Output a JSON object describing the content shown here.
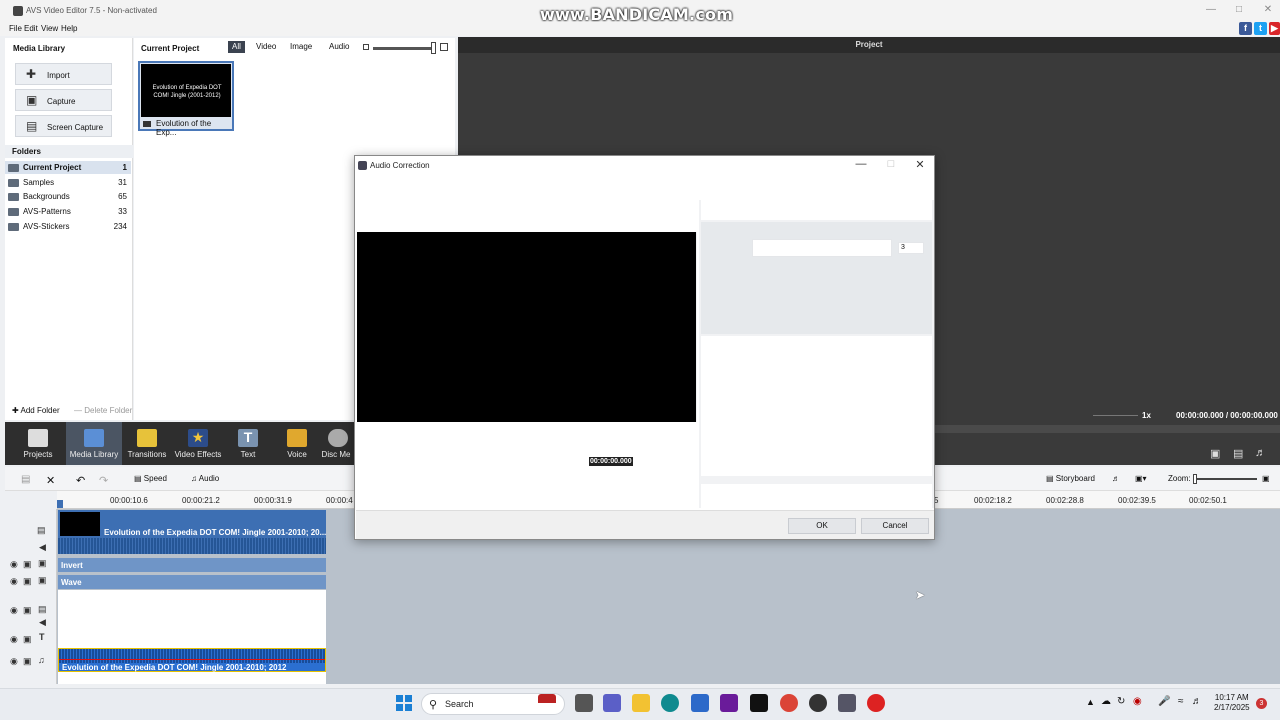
{
  "window": {
    "title": "AVS Video Editor 7.5 - Non-activated",
    "watermark": "www.BANDICAM.com"
  },
  "menu": [
    "File",
    "Edit",
    "View",
    "Help"
  ],
  "media_library": {
    "title": "Media Library",
    "buttons": [
      "Import",
      "Capture",
      "Screen Capture"
    ],
    "folders_title": "Folders",
    "folders": [
      {
        "name": "Current Project",
        "count": "1"
      },
      {
        "name": "Samples",
        "count": "31"
      },
      {
        "name": "Backgrounds",
        "count": "65"
      },
      {
        "name": "AVS-Patterns",
        "count": "33"
      },
      {
        "name": "AVS-Stickers",
        "count": "234"
      }
    ],
    "add_folder": "Add Folder",
    "delete_folder": "Delete Folder"
  },
  "current_project": {
    "title": "Current Project",
    "filters": [
      "All",
      "Video",
      "Image",
      "Audio"
    ],
    "active_filter": "All",
    "thumb_text": "Evolution of Expedia DOT COM! Jingle (2001-2012)",
    "thumb_caption": "Evolution of the Exp..."
  },
  "preview": {
    "title": "Project",
    "speed": "1x",
    "time": "00:00:00.000 / 00:00:00.000"
  },
  "toolbar": {
    "items": [
      "Projects",
      "Media Library",
      "Transitions",
      "Video Effects",
      "Text",
      "Voice",
      "Disc Me"
    ],
    "active": "Media Library"
  },
  "timeline": {
    "speed_label": "Speed",
    "audio_label": "Audio",
    "storyboard_label": "Storyboard",
    "zoom_label": "Zoom:",
    "ticks": [
      "00:00:10.6",
      "00:00:21.2",
      "00:00:31.9",
      "00:00:4",
      "5",
      "00:02:18.2",
      "00:02:28.8",
      "00:02:39.5",
      "00:02:50.1"
    ],
    "video_clip": "Evolution of the Expedia  DOT COM!  Jingle 2001-2010; 20...",
    "fx_invert": "Invert",
    "fx_wave": "Wave",
    "audio_clip": "Evolution of the Expedia  DOT COM!  Jingle 2001-2010; 2012"
  },
  "dialog": {
    "title": "Audio Correction",
    "time": "00:00:00.000",
    "number_value": "3",
    "ok": "OK",
    "cancel": "Cancel"
  },
  "taskbar": {
    "search": "Search",
    "time": "10:17 AM",
    "date": "2/17/2025",
    "notif_count": "3"
  },
  "colors": {
    "accent": "#3d6fb3",
    "dark_panel": "#3a3a3a",
    "toolbar_bg": "#2e2e2e"
  }
}
